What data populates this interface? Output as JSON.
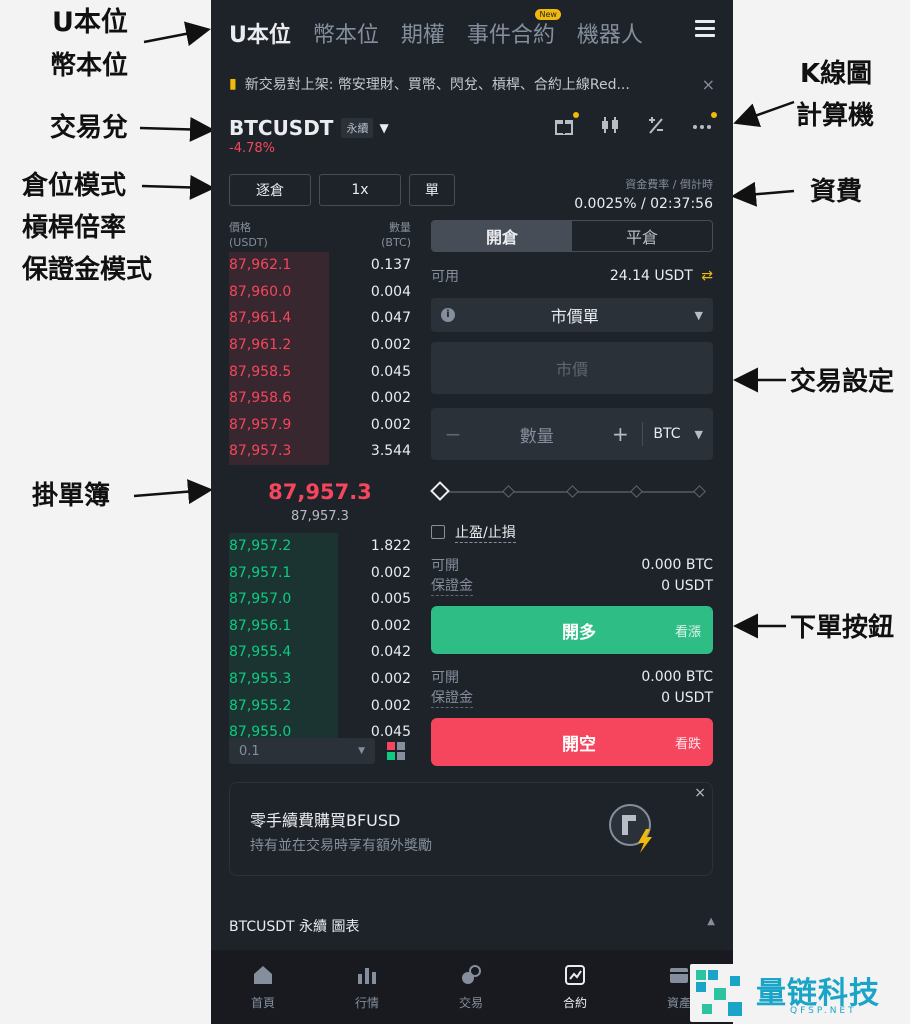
{
  "annotations": {
    "u_margin": "U本位",
    "coin_margin": "幣本位",
    "trading_pair": "交易兌",
    "position_mode": "倉位模式",
    "leverage": "槓桿倍率",
    "margin_mode": "保證金模式",
    "order_book": "掛單簿",
    "kline": "K線圖",
    "calculator": "計算機",
    "funding_fee": "資費",
    "trade_settings": "交易設定",
    "order_buttons": "下單按鈕"
  },
  "header": {
    "tabs": [
      {
        "label": "U本位",
        "active": true
      },
      {
        "label": "幣本位"
      },
      {
        "label": "期權"
      },
      {
        "label": "事件合約",
        "badge": "New"
      },
      {
        "label": "機器人"
      }
    ]
  },
  "notice": {
    "text": "新交易對上架: 幣安理財、買幣、閃兌、槓桿、合約上線Red...",
    "close": "×"
  },
  "pair": {
    "symbol": "BTCUSDT",
    "type": "永續",
    "change": "-4.78%"
  },
  "modes": {
    "margin": "逐倉",
    "leverage": "1x",
    "position": "單"
  },
  "funding": {
    "label": "資金費率 / 倒計時",
    "value": "0.0025% / 02:37:56"
  },
  "order_book": {
    "price_header": "價格",
    "price_unit": "(USDT)",
    "qty_header": "數量",
    "qty_unit": "(BTC)",
    "asks": [
      {
        "price": "87,962.1",
        "qty": "0.137",
        "depth": 0.55
      },
      {
        "price": "87,960.0",
        "qty": "0.004",
        "depth": 0.55
      },
      {
        "price": "87,961.4",
        "qty": "0.047",
        "depth": 0.55
      },
      {
        "price": "87,961.2",
        "qty": "0.002",
        "depth": 0.55
      },
      {
        "price": "87,958.5",
        "qty": "0.045",
        "depth": 0.55
      },
      {
        "price": "87,958.6",
        "qty": "0.002",
        "depth": 0.55
      },
      {
        "price": "87,957.9",
        "qty": "0.002",
        "depth": 0.55
      },
      {
        "price": "87,957.3",
        "qty": "3.544",
        "depth": 0.55
      }
    ],
    "last_price": "87,957.3",
    "mark_price": "87,957.3",
    "bids": [
      {
        "price": "87,957.2",
        "qty": "1.822",
        "depth": 0.6
      },
      {
        "price": "87,957.1",
        "qty": "0.002",
        "depth": 0.6
      },
      {
        "price": "87,957.0",
        "qty": "0.005",
        "depth": 0.6
      },
      {
        "price": "87,956.1",
        "qty": "0.002",
        "depth": 0.6
      },
      {
        "price": "87,955.4",
        "qty": "0.042",
        "depth": 0.6
      },
      {
        "price": "87,955.3",
        "qty": "0.002",
        "depth": 0.6
      },
      {
        "price": "87,955.2",
        "qty": "0.002",
        "depth": 0.6
      },
      {
        "price": "87,955.0",
        "qty": "0.045",
        "depth": 0.6
      }
    ],
    "depth_step": "0.1"
  },
  "trade": {
    "open_tab": "開倉",
    "close_tab": "平倉",
    "available_label": "可用",
    "available_value": "24.14 USDT",
    "order_type": "市價單",
    "price_placeholder": "市價",
    "qty_label": "數量",
    "qty_unit": "BTC",
    "tpsl_label": "止盈/止損",
    "long": {
      "can_open_label": "可開",
      "can_open_value": "0.000 BTC",
      "margin_label": "保證金",
      "margin_value": "0 USDT",
      "button": "開多",
      "sub": "看漲"
    },
    "short": {
      "can_open_label": "可開",
      "can_open_value": "0.000 BTC",
      "margin_label": "保證金",
      "margin_value": "0 USDT",
      "button": "開空",
      "sub": "看跌"
    }
  },
  "promo": {
    "title": "零手續費購買BFUSD",
    "subtitle": "持有並在交易時享有額外獎勵",
    "close": "×"
  },
  "chart_bar": {
    "label": "BTCUSDT 永續  圖表"
  },
  "bottom_nav": [
    {
      "label": "首頁",
      "icon": "home-icon"
    },
    {
      "label": "行情",
      "icon": "markets-icon"
    },
    {
      "label": "交易",
      "icon": "trade-icon"
    },
    {
      "label": "合約",
      "icon": "futures-icon",
      "active": true
    },
    {
      "label": "資產",
      "icon": "wallet-icon"
    }
  ],
  "watermark": {
    "cn": "量链科技",
    "en": "QFSP.NET"
  },
  "colors": {
    "bg": "#1e2329",
    "up": "#0ecb81",
    "down": "#f6465d",
    "accent": "#f0b90b"
  }
}
